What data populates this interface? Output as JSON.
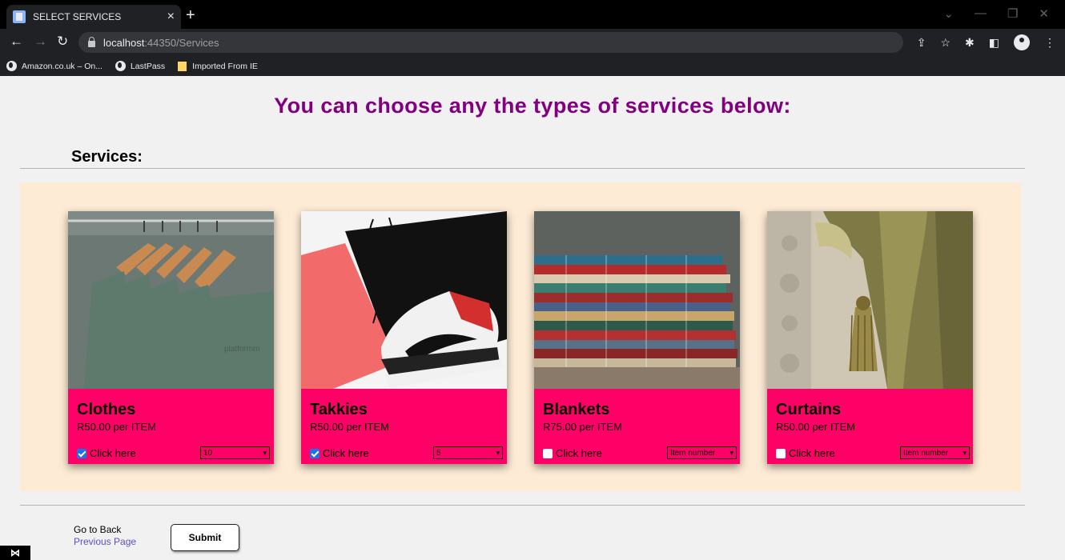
{
  "browser": {
    "tab_title": "SELECT SERVICES",
    "tab_close": "×",
    "new_tab": "+",
    "url_host": "localhost",
    "url_rest": ":44350/Services",
    "bookmarks": [
      {
        "label": "Amazon.co.uk – On..."
      },
      {
        "label": "LastPass"
      },
      {
        "label": "Imported From IE"
      }
    ]
  },
  "page": {
    "title": "You can choose any the types of services below:",
    "section_heading": "Services:"
  },
  "cards": [
    {
      "title": "Clothes",
      "price": "R50.00 per ITEM",
      "checkbox_label": "Click here",
      "checked": true,
      "select_value": "10"
    },
    {
      "title": "Takkies",
      "price": "R50.00 per ITEM",
      "checkbox_label": "Click here",
      "checked": true,
      "select_value": "5"
    },
    {
      "title": "Blankets",
      "price": "R75.00 per ITEM",
      "checkbox_label": "Click here",
      "checked": false,
      "select_value": "Item number"
    },
    {
      "title": "Curtains",
      "price": "R50.00 per ITEM",
      "checkbox_label": "Click here",
      "checked": false,
      "select_value": "Item number"
    }
  ],
  "footer": {
    "back_text": "Go to Back",
    "back_link": "Previous Page",
    "submit_label": "Submit"
  },
  "colors": {
    "title": "#800080",
    "card": "#ff0066",
    "panel": "#fdebd5"
  }
}
